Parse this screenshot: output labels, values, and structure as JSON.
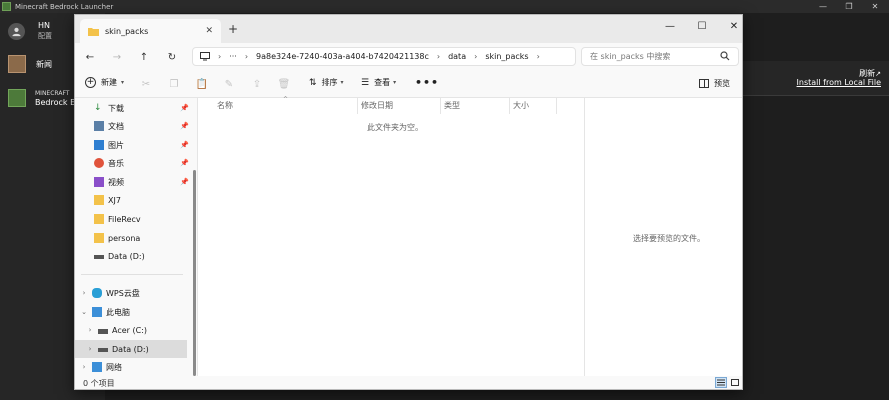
{
  "launcher": {
    "window_title": "Minecraft Bedrock Launcher",
    "controls": [
      "—",
      "❐",
      "✕"
    ],
    "profile": {
      "name": "HN",
      "subtitle": "配置"
    },
    "nav": [
      {
        "label": "新闻"
      },
      {
        "line1": "MINECRAFT",
        "line2": "Bedrock Ed"
      }
    ],
    "refresh": "刷新",
    "install": "Install from Local File"
  },
  "explorer": {
    "tab_title": "skin_packs",
    "tab_close": "✕",
    "tab_add": "+",
    "controls": {
      "minimize": "—",
      "maximize": "☐",
      "close": "✕"
    },
    "nav_buttons": {
      "back": "←",
      "forward": "→",
      "up": "↑",
      "refresh": "↻"
    },
    "address": {
      "ellipsis": "···",
      "segments": [
        "9a8e324e-7240-403a-a404-b7420421138c",
        "data",
        "skin_packs"
      ]
    },
    "search_placeholder": "在 skin_packs 中搜索",
    "toolbar": {
      "new_label": "新建",
      "sort_label": "排序",
      "view_label": "查看",
      "more": "•••",
      "preview_label": "预览"
    },
    "navpane": {
      "quick": [
        {
          "label": "下载",
          "pin": "📌"
        },
        {
          "label": "文档",
          "pin": "📌"
        },
        {
          "label": "图片",
          "pin": "📌"
        },
        {
          "label": "音乐",
          "pin": "📌"
        },
        {
          "label": "视频",
          "pin": "📌"
        },
        {
          "label": "XJ7"
        },
        {
          "label": "FileRecv"
        },
        {
          "label": "persona"
        },
        {
          "label": "Data (D:)"
        }
      ],
      "tree": [
        {
          "label": "WPS云盘"
        },
        {
          "label": "此电脑"
        },
        {
          "label": "Acer (C:)"
        },
        {
          "label": "Data (D:)"
        },
        {
          "label": "网络"
        }
      ]
    },
    "columns": [
      "名称",
      "修改日期",
      "类型",
      "大小"
    ],
    "empty_message": "此文件夹为空。",
    "preview_message": "选择要预览的文件。",
    "status": "0 个项目"
  }
}
